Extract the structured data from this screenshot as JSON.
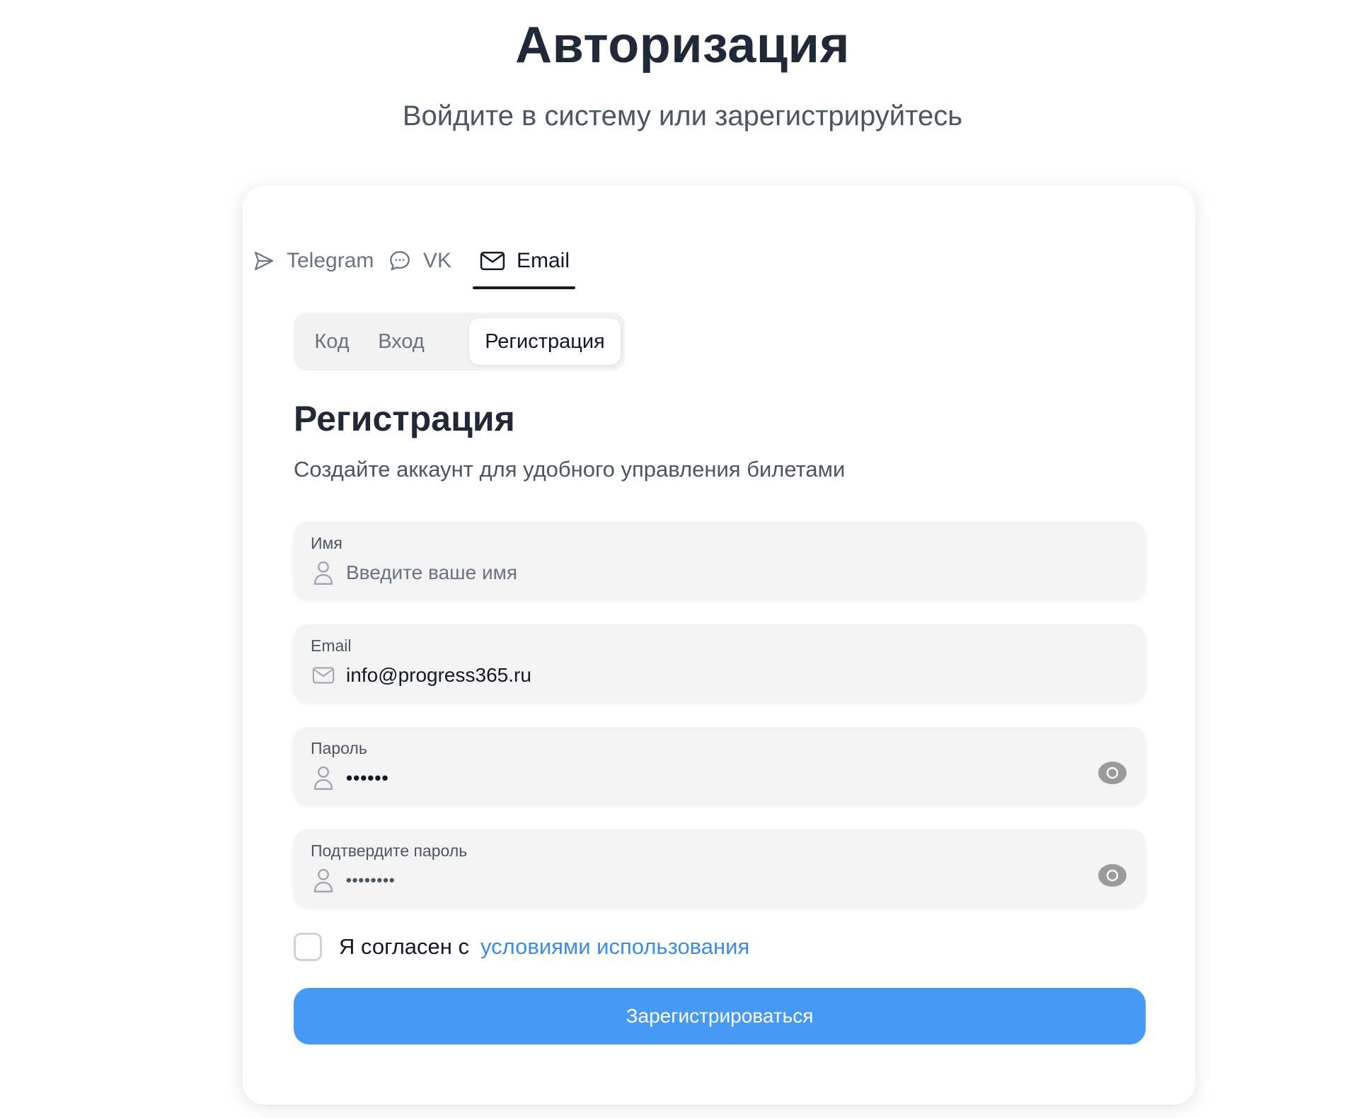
{
  "header": {
    "title": "Авторизация",
    "subtitle": "Войдите в систему или зарегистрируйтесь"
  },
  "provider_tabs": [
    {
      "label": "Telegram",
      "icon": "send-icon",
      "active": false
    },
    {
      "label": "VK",
      "icon": "chat-bubble-icon",
      "active": false
    },
    {
      "label": "Email",
      "icon": "mail-icon",
      "active": true
    }
  ],
  "mode_tabs": [
    {
      "label": "Код",
      "active": false
    },
    {
      "label": "Вход",
      "active": false
    },
    {
      "label": "Регистрация",
      "active": true
    }
  ],
  "form": {
    "title": "Регистрация",
    "description": "Создайте аккаунт для удобного управления билетами",
    "fields": {
      "name": {
        "label": "Имя",
        "placeholder": "Введите ваше имя",
        "value": "",
        "icon": "user-icon"
      },
      "email": {
        "label": "Email",
        "value": "info@progress365.ru",
        "icon": "mail-icon"
      },
      "password": {
        "label": "Пароль",
        "value": "••••••",
        "icon": "user-icon",
        "toggle_icon": "eye-icon"
      },
      "confirm_password": {
        "label": "Подтвердите пароль",
        "value": "••••••••",
        "icon": "user-icon",
        "toggle_icon": "eye-icon"
      }
    },
    "terms": {
      "checked": false,
      "text": "Я согласен с",
      "link": "условиями использования"
    },
    "submit_label": "Зарегистрироваться"
  },
  "colors": {
    "accent": "#4699f4",
    "link": "#3b8be8",
    "heading": "#1f2937",
    "field_bg": "#f3f3f3"
  }
}
